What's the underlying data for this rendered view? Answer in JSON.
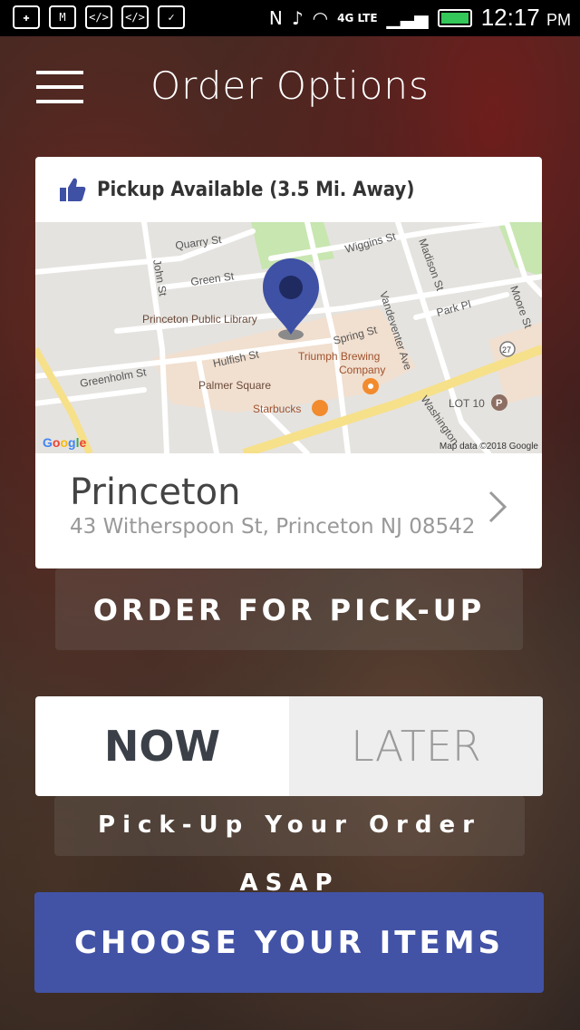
{
  "statusbar": {
    "time": "12:17",
    "ampm": "PM",
    "network": "4G LTE"
  },
  "header": {
    "title": "Order Options"
  },
  "card": {
    "pickup_status": "Pickup Available (3.5 Mi. Away)",
    "map": {
      "labels": [
        "Quarry St",
        "Wiggins St",
        "Madison St",
        "Moore St",
        "John St",
        "Green St",
        "Park Pl",
        "Princeton Public Library",
        "Vandeventer Ave",
        "Spring St",
        "Hulfish St",
        "Triumph Brewing",
        "Company",
        "Greenholm St",
        "Palmer Square",
        "LOT 10",
        "Starbucks",
        "Washington",
        "27"
      ],
      "credit": "Map data ©2018 Google",
      "logo": "Google"
    },
    "store_name": "Princeton",
    "store_address": "43 Witherspoon St, Princeton NJ 08542"
  },
  "order_for_pickup_label": "ORDER FOR PICK-UP",
  "timing": {
    "now_label": "NOW",
    "later_label": "LATER",
    "selected": "NOW"
  },
  "asap_text": "Pick-Up Your Order ASAP",
  "cta_label": "CHOOSE YOUR ITEMS",
  "colors": {
    "accent": "#4253a6",
    "pin": "#3f51a5",
    "status_bar": "#000000"
  }
}
